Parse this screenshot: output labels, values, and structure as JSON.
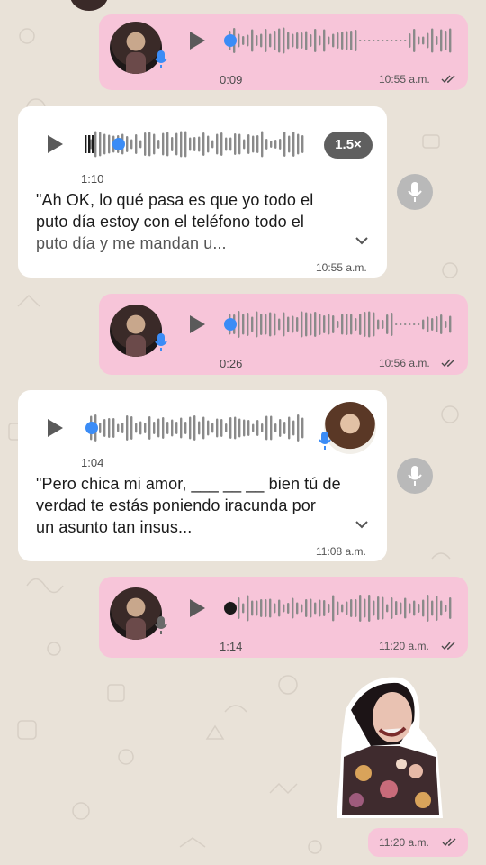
{
  "messages": [
    {
      "kind": "out-voice",
      "duration": "0:09",
      "time": "10:55 a.m."
    },
    {
      "kind": "in-voice",
      "duration": "1:10",
      "speed": "1.5×",
      "transcript_line1": "\"Ah OK, lo qué pasa es que yo todo el",
      "transcript_line2": "puto día estoy con el teléfono todo el",
      "transcript_line3": "puto día y me mandan u...",
      "time": "10:55 a.m."
    },
    {
      "kind": "out-voice",
      "duration": "0:26",
      "time": "10:56 a.m."
    },
    {
      "kind": "in-voice",
      "duration": "1:04",
      "transcript_line1": "\"Pero chica mi amor, ___ __ __ bien tú de",
      "transcript_line2": "verdad te estás poniendo iracunda por",
      "transcript_line3": "un asunto tan insus...",
      "time": "11:08 a.m."
    },
    {
      "kind": "out-voice",
      "duration": "1:14",
      "time": "11:20 a.m."
    },
    {
      "kind": "out-sticker",
      "time": "11:20 a.m."
    }
  ],
  "colors": {
    "outgoing_bubble": "#f7c5d9",
    "incoming_bubble": "#ffffff",
    "played_dot": "#3b8cf6",
    "read_ticks": "#4a4a4a"
  },
  "icons": [
    "play-icon",
    "mic-icon",
    "double-check-icon",
    "chevron-down-icon"
  ]
}
